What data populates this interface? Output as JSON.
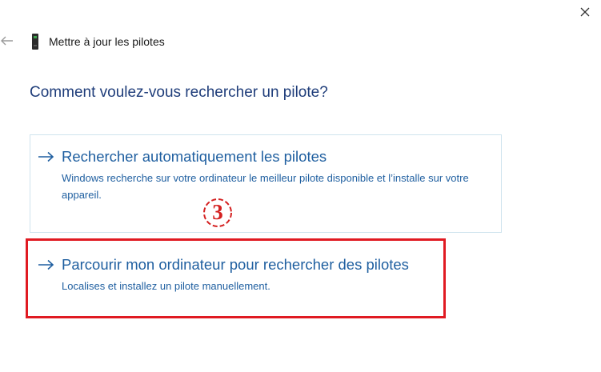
{
  "header": {
    "title": "Mettre à jour les pilotes",
    "back_icon": "back-arrow-icon",
    "device_icon": "device-icon",
    "close_icon": "close-icon"
  },
  "main": {
    "question": "Comment voulez-vous rechercher un pilote?",
    "options": [
      {
        "title": "Rechercher automatiquement les pilotes",
        "description": "Windows recherche sur votre ordinateur le meilleur pilote disponible et l’installe sur votre appareil."
      },
      {
        "title": "Parcourir mon ordinateur pour rechercher des pilotes",
        "description": "Localises et installez un pilote manuellement."
      }
    ]
  },
  "annotation": {
    "step_number": "3",
    "highlight_color": "#e01a22"
  },
  "colors": {
    "accent": "#1f5fa0",
    "heading": "#1f3d7a",
    "annotation": "#e01a22"
  }
}
